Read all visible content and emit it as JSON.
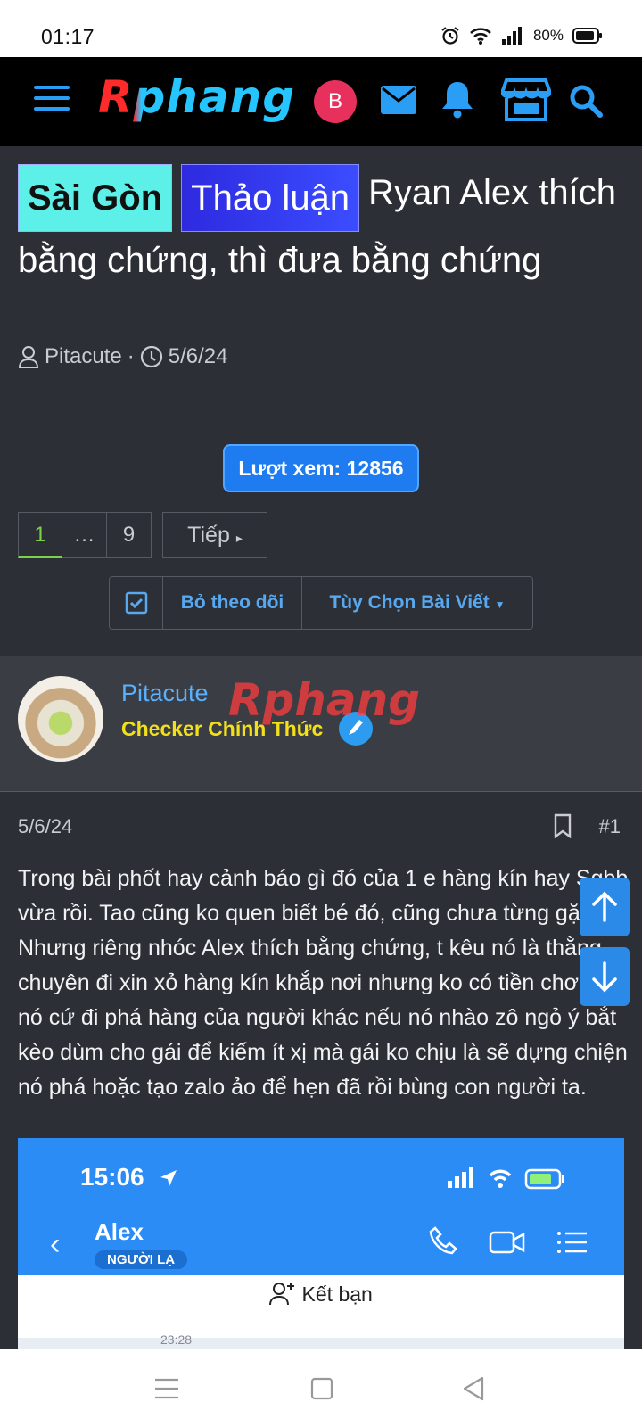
{
  "status_bar": {
    "time": "01:17",
    "battery": "80%"
  },
  "nav": {
    "logo": "Rphang",
    "avatar_letter": "B"
  },
  "thread": {
    "tag1": "Sài Gòn",
    "tag2": "Thảo luận",
    "title": "Ryan Alex thích bằng chứng, thì đưa bằng chứng",
    "author": "Pitacute",
    "date": "5/6/24",
    "views": "Lượt xem: 12856",
    "pages": {
      "current": "1",
      "dots": "…",
      "last": "9",
      "next": "Tiếp"
    },
    "actions": {
      "unwatch": "Bỏ theo dõi",
      "options": "Tùy Chọn Bài Viết"
    }
  },
  "post": {
    "author_name": "Pitacute",
    "author_rank": "Checker Chính Thức",
    "watermark": "Rphang",
    "date": "5/6/24",
    "number": "#1",
    "text": "Trong bài phốt hay cảnh báo gì đó của 1 e hàng kín hay Sgbb vừa rồi. Tao cũng ko quen biết bé đó, cũng chưa từng gặp. Nhưng riêng nhóc Alex thích bằng chứng, t kêu nó là thằng chuyên đi xin xỏ hàng kín khắp nơi nhưng ko có tiền chơi, mà nó cứ đi phá hàng của người khác nếu nó nhào zô ngỏ ý bắt kèo dùm cho gái để kiếm ít xị mà gái ko chịu là sẽ dựng chiện nó phá hoặc tạo zalo ảo để hẹn đã rồi bùng con người ta."
  },
  "embed": {
    "time": "15:06",
    "contact_name": "Alex",
    "badge": "NGƯỜI LẠ",
    "add_friend": "Kết bạn",
    "msg_time": "23:28"
  }
}
